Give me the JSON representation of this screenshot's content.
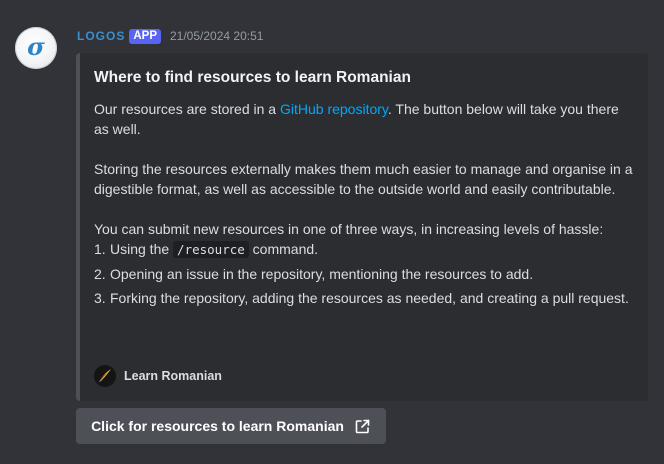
{
  "message": {
    "author": "LOGOS",
    "badge": "APP",
    "timestamp": "21/05/2024 20:51",
    "avatar_icon": "sigma-logo",
    "avatar_glyph": "σ"
  },
  "embed": {
    "title": "Where to find resources to learn Romanian",
    "intro_before_link": "Our resources are stored in a ",
    "intro_link": "GitHub repository",
    "intro_after_link": ". The button below will take you there as well.",
    "paragraph2": "Storing the resources externally makes them much easier to manage and organise in a digestible format, as well as accessible to the outside world and easily contributable.",
    "paragraph3": "You can submit new resources in one of three ways, in increasing levels of hassle:",
    "steps": [
      {
        "num": "1.",
        "before": "Using the ",
        "code": "/resource",
        "after": " command."
      },
      {
        "num": "2.",
        "text": "Opening an issue in the repository, mentioning the resources to add."
      },
      {
        "num": "3.",
        "text": "Forking the repository, adding the resources as needed, and creating a pull request."
      }
    ],
    "footer_text": "Learn Romanian",
    "footer_icon": "romanian-feather-logo",
    "accent_color": "#4e5058"
  },
  "button": {
    "label": "Click for resources to learn Romanian",
    "icon": "external-link-icon"
  },
  "colors": {
    "background": "#313338",
    "embed_background": "#2b2d31",
    "username": "#3a8fd0",
    "badge": "#5865f2",
    "link": "#00a8fc",
    "button": "#4e5058"
  }
}
